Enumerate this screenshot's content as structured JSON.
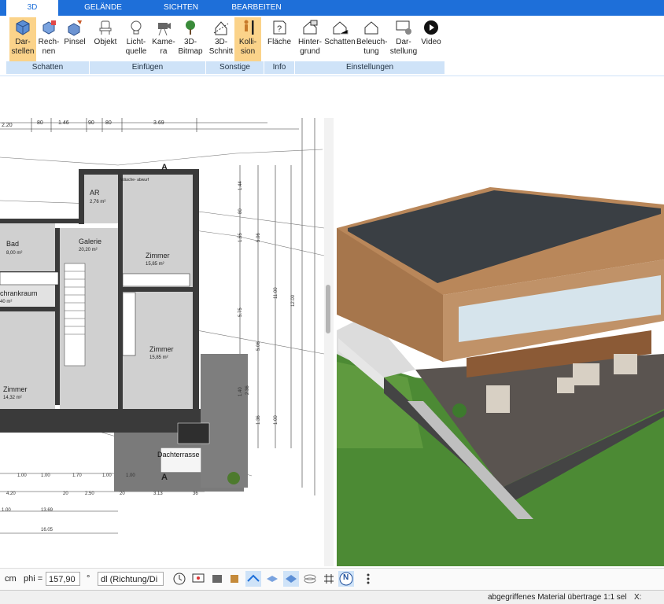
{
  "tabs": [
    {
      "label": "3D",
      "active": true
    },
    {
      "label": "GELÄNDE",
      "active": false
    },
    {
      "label": "SICHTEN",
      "active": false
    },
    {
      "label": "BEARBEITEN",
      "active": false
    }
  ],
  "ribbon": {
    "buttons": [
      {
        "label": "Dar-\nstellen",
        "icon": "cube-icon",
        "selected": true
      },
      {
        "label": "Rech-\nnen",
        "icon": "cube-calc-icon",
        "selected": false
      },
      {
        "label": "Pinsel",
        "icon": "brush-cube-icon",
        "selected": false
      },
      {
        "label": "Objekt",
        "icon": "chair-icon",
        "selected": false
      },
      {
        "label": "Licht-\nquelle",
        "icon": "bulb-icon",
        "selected": false
      },
      {
        "label": "Kame-\nra",
        "icon": "camera-icon",
        "selected": false
      },
      {
        "label": "3D-\nBitmap",
        "icon": "tree-icon",
        "selected": false
      },
      {
        "label": "3D-\nSchnitt",
        "icon": "cut-icon",
        "selected": false
      },
      {
        "label": "Kolli-\nsion",
        "icon": "person-icon",
        "selected": true
      },
      {
        "label": "Fläche",
        "icon": "area-info-icon",
        "selected": false
      },
      {
        "label": "Hinter-\ngrund",
        "icon": "house-bg-icon",
        "selected": false
      },
      {
        "label": "Schatten",
        "icon": "house-shadow-icon",
        "selected": false
      },
      {
        "label": "Beleuch-\ntung",
        "icon": "house-light-icon",
        "selected": false
      },
      {
        "label": "Dar-\nstellung",
        "icon": "monitor-gear-icon",
        "selected": false
      },
      {
        "label": "Video",
        "icon": "play-icon",
        "selected": false
      }
    ],
    "groups": [
      "Schatten",
      "Einfügen",
      "Sonstige",
      "Info",
      "Einstellungen"
    ]
  },
  "plan": {
    "dimensions_top": [
      "2.20",
      "80",
      "1.46",
      "90",
      "80",
      "3.69"
    ],
    "dimensions_bottom": [
      "1.00",
      "1.00",
      "1.70",
      "1.00",
      "1.00",
      "4.20",
      "20",
      "2.50",
      "20",
      "3.13",
      "36",
      "13.69",
      "1.00",
      "16.05"
    ],
    "dimensions_right": [
      "1.44",
      "80",
      "1.55",
      "5.06",
      "5.75",
      "11.00",
      "12.00",
      "5.06",
      "1.40",
      "2.36",
      "1.36",
      "1.00"
    ],
    "rooms": [
      {
        "name": "AR",
        "area": "2,76 m²"
      },
      {
        "name": "Bad",
        "area": "8,00 m²"
      },
      {
        "name": "Galerie",
        "area": "20,20 m²"
      },
      {
        "name": "Zimmer",
        "area": "15,85 m²"
      },
      {
        "name": "chrankraum",
        "area": "40 m²"
      },
      {
        "name": "Zimmer",
        "area": "15,85 m²"
      },
      {
        "name": "Zimmer",
        "area": "14,32 m²"
      },
      {
        "name": "Dachterrasse",
        "area": ""
      }
    ],
    "washer_label": "Wäsche-\nabwurf",
    "section_mark": "A"
  },
  "toolbar": {
    "unit": "cm",
    "phi_label": "phi =",
    "phi_value": "157,90",
    "degree": "°",
    "direction_select": "dl (Richtung/Di",
    "north_label": "N"
  },
  "status": {
    "message": "abgegriffenes Material übertrage 1:1 sel",
    "coord_label": "X:"
  },
  "colors": {
    "accent": "#1e6fd9",
    "selected": "#fbd38a",
    "group": "#cfe3f8"
  }
}
